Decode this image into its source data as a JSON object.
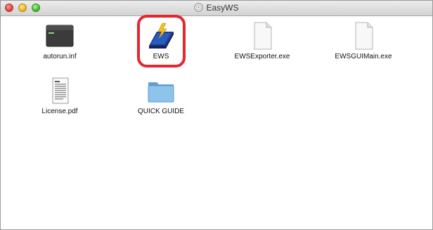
{
  "window": {
    "title": "EasyWS",
    "title_icon": "disk-icon"
  },
  "files": [
    {
      "name": "autorun.inf",
      "icon": "inf-file-icon"
    },
    {
      "name": "EWS",
      "icon": "ews-app-icon"
    },
    {
      "name": "EWSExporter.exe",
      "icon": "exe-file-icon"
    },
    {
      "name": "EWSGUIMain.exe",
      "icon": "exe-file-icon"
    },
    {
      "name": "License.pdf",
      "icon": "pdf-file-icon"
    },
    {
      "name": "QUICK GUIDE",
      "icon": "folder-icon"
    }
  ],
  "colors": {
    "highlight": "#e4262f",
    "folder": "#7fb6df"
  }
}
